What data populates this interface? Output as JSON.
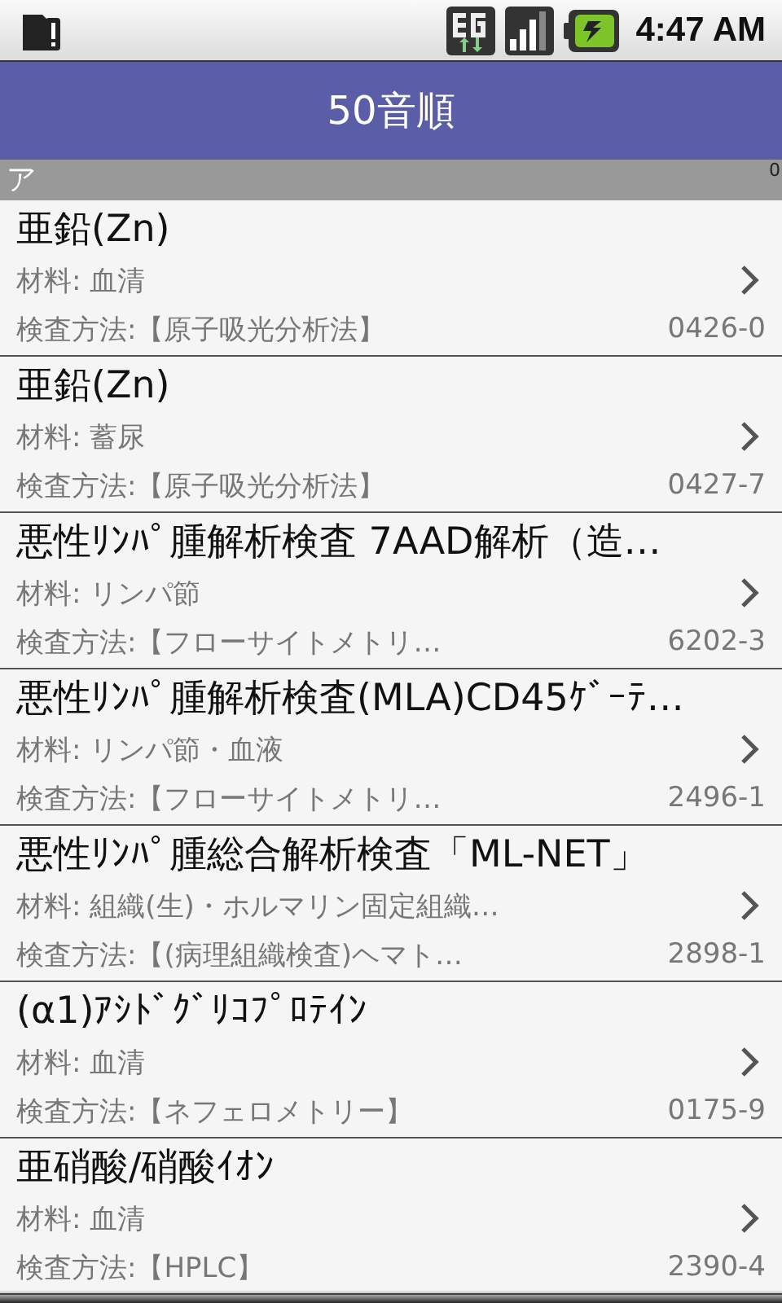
{
  "status_bar": {
    "time": "4:47 AM"
  },
  "title_bar": {
    "title": "50音順"
  },
  "section": {
    "label": "ア",
    "index_mark": "0"
  },
  "items": [
    {
      "title": "亜鉛(Zn)",
      "material": "材料: 血清",
      "method": "検査方法:【原子吸光分析法】",
      "code": "0426-0"
    },
    {
      "title": "亜鉛(Zn)",
      "material": "材料: 蓄尿",
      "method": "検査方法:【原子吸光分析法】",
      "code": "0427-7"
    },
    {
      "title": "悪性ﾘﾝﾊﾟ腫解析検査 7AAD解析（造…",
      "material": "材料: リンパ節",
      "method": "検査方法:【フローサイトメトリ…",
      "code": "6202-3"
    },
    {
      "title": "悪性ﾘﾝﾊﾟ腫解析検査(MLA)CD45ｹﾞｰﾃ…",
      "material": "材料: リンパ節・血液",
      "method": "検査方法:【フローサイトメトリ…",
      "code": "2496-1"
    },
    {
      "title": "悪性ﾘﾝﾊﾟ腫総合解析検査「ML-NET」",
      "material": "材料: 組織(生)・ホルマリン固定組織…",
      "method": "検査方法:【(病理組織検査)ヘマト…",
      "code": "2898-1"
    },
    {
      "title": "(α1)ｱｼﾄﾞｸﾞﾘｺﾌﾟﾛﾃｲﾝ",
      "material": "材料: 血清",
      "method": "検査方法:【ネフェロメトリー】",
      "code": "0175-9"
    },
    {
      "title": "亜硝酸/硝酸ｲｵﾝ",
      "material": "材料: 血清",
      "method": "検査方法:【HPLC】",
      "code": "2390-4"
    }
  ]
}
